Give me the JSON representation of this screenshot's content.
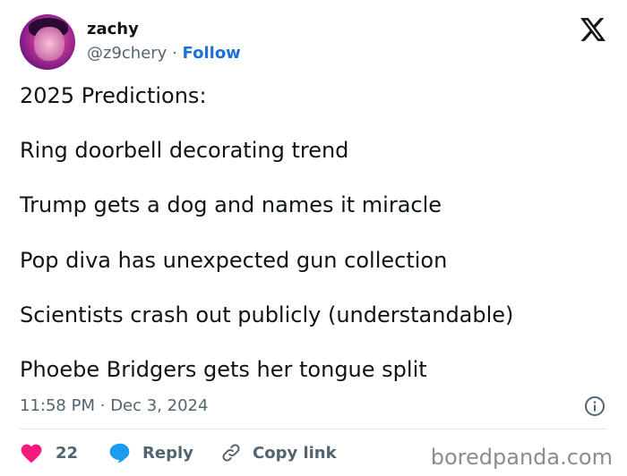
{
  "author": {
    "name": "zachy",
    "handle": "@z9chery",
    "separator": "·",
    "follow_label": "Follow"
  },
  "post": {
    "lines": [
      "2025 Predictions:",
      "Ring doorbell decorating trend",
      "Trump gets a dog and names it miracle",
      "Pop diva has unexpected gun collection",
      "Scientists crash out publicly (understandable)",
      "Phoebe Bridgers gets her tongue split"
    ],
    "time": "11:58 PM",
    "date_separator": "·",
    "date": "Dec 3, 2024"
  },
  "actions": {
    "like_count": "22",
    "reply_label": "Reply",
    "copy_link_label": "Copy link"
  },
  "watermark": "boredpanda.com",
  "colors": {
    "link_blue": "#1d72d8",
    "like_red": "#f91880",
    "reply_blue": "#1d9bf0",
    "secondary_text": "#536471"
  }
}
